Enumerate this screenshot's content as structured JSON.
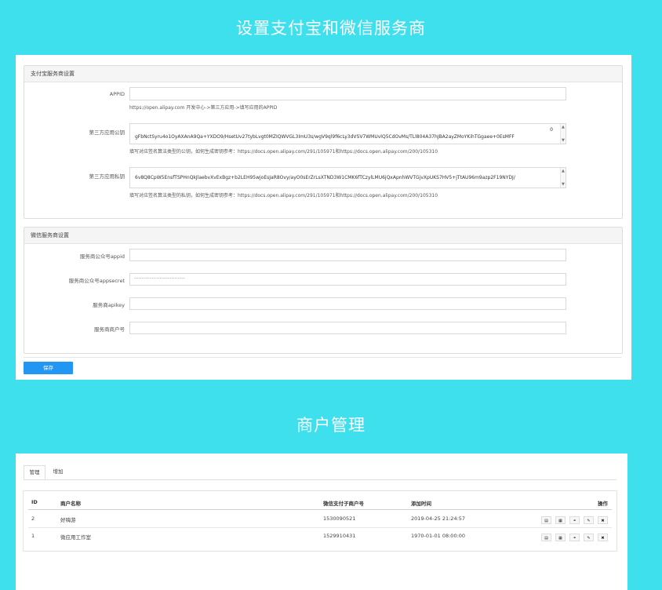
{
  "page": {
    "title1": "设置支付宝和微信服务商",
    "title2": "商户管理"
  },
  "alipay": {
    "heading": "支付宝服务商设置",
    "appid_label": "APPID",
    "appid_value": "",
    "appid_help": "https://open.alipay.com 开发中心->第三方应用->填写应用的APPID",
    "pubkey_label": "第三方应用公钥",
    "pubkey_line1": "",
    "pubkey_line1_end": "0",
    "pubkey_line2": "gFbNctSyru4o1OyAXAnA9Qa+YXDO9/HsetUv27tybLvgt0MZIQWVGL3ImU3s/wgV9ql9f6cLy3dVSV7WMUvlQ5CdOvMs/TLl804A37hJBA2ayZMoYKihTGgaee+0EsMFF",
    "pubkey_help": "填写对应签名算法类型的公钥，如何生成密钥参考：https://docs.open.alipay.com/291/105971和https://docs.open.alipay.com/200/105310",
    "privkey_label": "第三方应用私钥",
    "privkey_line1": "6v8Q8CpW5EnsfTSPHnQkJlaebvXvExBgz+b2LEH95wjoEsJaR8Ovy/ayO0sErZrLsXTND3W1CMK6fTCzylLMU6jQxApnhWVTGjvXpUKS7HV5+jTtAU96m9azp2F19NYDJ/",
    "privkey_help": "填写对应签名算法类型的私钥，如何生成密钥参考：https://docs.open.alipay.com/291/105971和https://docs.open.alipay.com/200/105310"
  },
  "wechat": {
    "heading": "微信服务商设置",
    "appid_label": "服务商公众号appid",
    "appid_value": "",
    "secret_label": "服务商公众号appsecret",
    "secret_value": "··································",
    "apikey_label": "服务商apikey",
    "apikey_value": "",
    "mchid_label": "服务商商户号",
    "mchid_value": ""
  },
  "save_label": "保存",
  "merchant": {
    "tabs": [
      "管理",
      "增加"
    ],
    "columns": [
      "ID",
      "商户名称",
      "微信支付子商户号",
      "添加时间",
      "操作"
    ],
    "rows": [
      {
        "id": "2",
        "name": "好嗨游",
        "sub_mch": "1530090521",
        "time": "2019-04-25 21:24:57"
      },
      {
        "id": "1",
        "name": "微应用工作室",
        "sub_mch": "1529910431",
        "time": "1970-01-01 08:00:00"
      }
    ],
    "op_icons": [
      "list-icon",
      "qr-icon",
      "link-icon",
      "edit-icon",
      "delete-icon"
    ]
  }
}
